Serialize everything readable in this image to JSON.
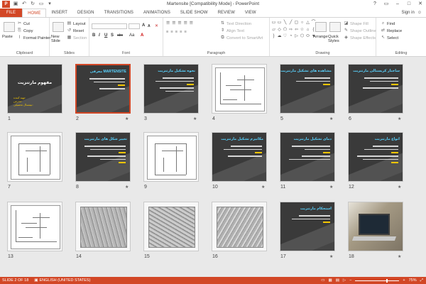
{
  "window": {
    "title": "Martensite [Compatibility Mode] - PowerPoint",
    "app_badge": "P"
  },
  "tabs": [
    {
      "label": "FILE"
    },
    {
      "label": "HOME"
    },
    {
      "label": "INSERT"
    },
    {
      "label": "DESIGN"
    },
    {
      "label": "TRANSITIONS"
    },
    {
      "label": "ANIMATIONS"
    },
    {
      "label": "SLIDE SHOW"
    },
    {
      "label": "REVIEW"
    },
    {
      "label": "VIEW"
    }
  ],
  "signin": "Sign in",
  "ribbon": {
    "clipboard": {
      "label": "Clipboard",
      "paste": "Paste",
      "cut": "Cut",
      "copy": "Copy",
      "format_painter": "Format Painter"
    },
    "slides": {
      "label": "Slides",
      "new_slide": "New Slide",
      "layout": "Layout",
      "reset": "Reset",
      "section": "Section"
    },
    "font": {
      "label": "Font",
      "bold": "B",
      "italic": "I",
      "underline": "U",
      "strike": "S",
      "abc": "abc",
      "aa": "Aa",
      "grow": "A",
      "shrink": "A"
    },
    "paragraph": {
      "label": "Paragraph",
      "text_direction": "Text Direction",
      "align_text": "Align Text",
      "smartart": "Convert to SmartArt"
    },
    "drawing": {
      "label": "Drawing",
      "arrange": "Arrange",
      "quick_styles": "Quick Styles",
      "shape_fill": "Shape Fill",
      "shape_outline": "Shape Outline",
      "shape_effects": "Shape Effects"
    },
    "editing": {
      "label": "Editing",
      "find": "Find",
      "replace": "Replace",
      "select": "Select"
    }
  },
  "slides": [
    {
      "num": "1",
      "title": "مفهوم مارتنزیت",
      "kind": "cover",
      "sub": "تهیه کننده:\nمدرس:\nنیمسال تحصیلی:",
      "star": ""
    },
    {
      "num": "2",
      "title": "معرفی MARTENSITE",
      "kind": "text",
      "star": "★",
      "selected": true
    },
    {
      "num": "3",
      "title": "نحوه تشکیل مارتنزیت",
      "kind": "text",
      "star": "★"
    },
    {
      "num": "4",
      "title": "",
      "kind": "diagram",
      "star": ""
    },
    {
      "num": "5",
      "title": "مشاهده های تشکیل مارتنزیت",
      "kind": "text",
      "star": "★"
    },
    {
      "num": "6",
      "title": "ساختار کریستالی مارتنزیت",
      "kind": "text",
      "star": "★"
    },
    {
      "num": "7",
      "title": "",
      "kind": "sketch",
      "star": ""
    },
    {
      "num": "8",
      "title": "تغییر شکل های مارتنزیت",
      "kind": "text",
      "star": "★"
    },
    {
      "num": "9",
      "title": "",
      "kind": "sketch",
      "star": ""
    },
    {
      "num": "10",
      "title": "مکانیزم تشکیل مارتنزیت",
      "kind": "text",
      "star": "★"
    },
    {
      "num": "11",
      "title": "دمای تشکیل مارتنزیت",
      "kind": "text",
      "star": "★"
    },
    {
      "num": "12",
      "title": "انواع مارتنزیت",
      "kind": "text",
      "star": "★"
    },
    {
      "num": "13",
      "title": "",
      "kind": "diagram",
      "star": ""
    },
    {
      "num": "14",
      "title": "",
      "kind": "photo",
      "star": ""
    },
    {
      "num": "15",
      "title": "",
      "kind": "photo",
      "star": ""
    },
    {
      "num": "16",
      "title": "",
      "kind": "photo",
      "star": ""
    },
    {
      "num": "17",
      "title": "استحکام مارتنزیت",
      "kind": "text",
      "star": "★"
    },
    {
      "num": "18",
      "title": "",
      "kind": "laptop",
      "star": "★"
    }
  ],
  "status": {
    "slide_of": "SLIDE 2 OF 18",
    "language": "ENGLISH (UNITED STATES)",
    "zoom": "75%",
    "zoom_minus": "−",
    "zoom_plus": "+"
  }
}
